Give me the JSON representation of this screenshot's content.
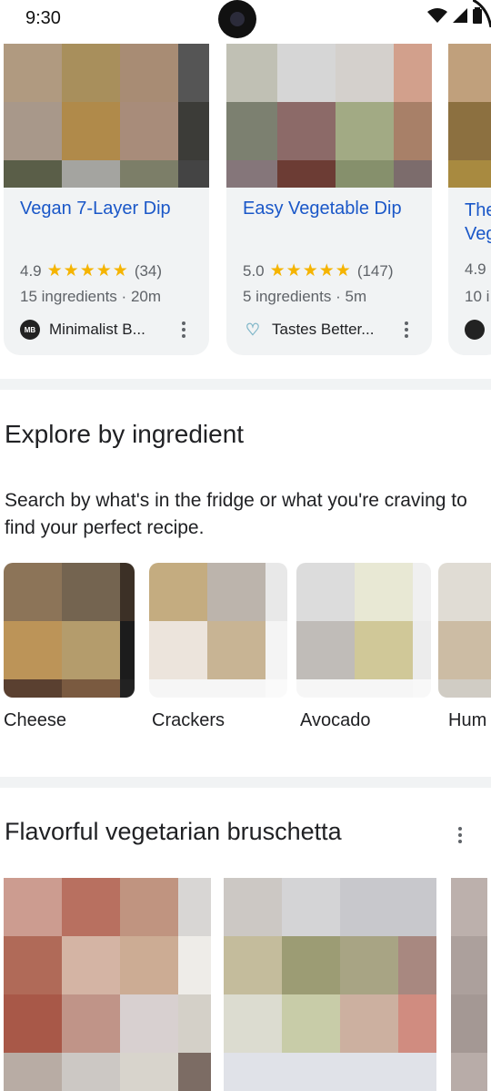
{
  "status_bar": {
    "time": "9:30"
  },
  "recipes": [
    {
      "title": "Vegan 7-Layer Dip",
      "rating": "4.9",
      "stars": "★★★★★",
      "reviews": "(34)",
      "ingredients": "15 ingredients",
      "time": "20m",
      "source": "Minimalist B...",
      "source_logo": "MB"
    },
    {
      "title": "Easy Vegetable Dip",
      "rating": "5.0",
      "stars": "★★★★★",
      "reviews": "(147)",
      "ingredients": "5 ingredients",
      "time": "5m",
      "source": "Tastes Better...",
      "source_logo": "♡"
    },
    {
      "title": "The Vegan...",
      "rating": "4.9",
      "ingredients": "10 i",
      "source_logo": ""
    }
  ],
  "explore": {
    "title": "Explore by ingredient",
    "description": "Search by what's in the fridge or what you're craving to find your perfect recipe.",
    "ingredients": [
      "Cheese",
      "Crackers",
      "Avocado",
      "Hum"
    ]
  },
  "bruschetta": {
    "title": "Flavorful vegetarian bruschetta"
  },
  "dot_separator": "·"
}
